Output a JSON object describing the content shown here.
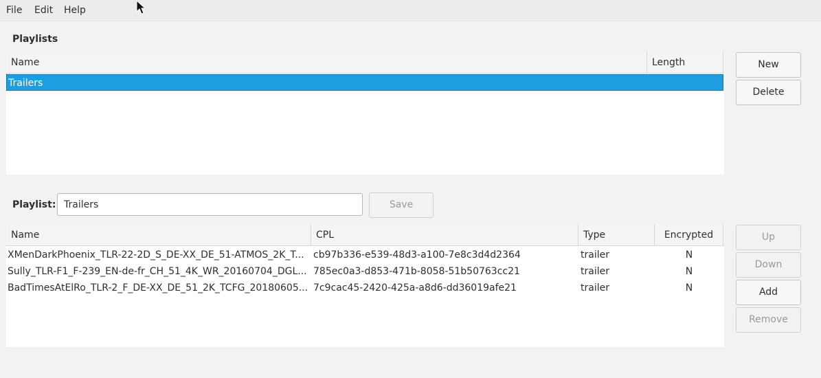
{
  "menu": {
    "file": "File",
    "edit": "Edit",
    "help": "Help"
  },
  "playlists": {
    "label": "Playlists",
    "columns": {
      "name": "Name",
      "length": "Length"
    },
    "rows": [
      {
        "name": "Trailers",
        "length": "",
        "selected": true
      }
    ],
    "buttons": {
      "new": "New",
      "delete": "Delete"
    }
  },
  "editor": {
    "label": "Playlist:",
    "name_value": "Trailers",
    "save": "Save",
    "columns": {
      "name": "Name",
      "cpl": "CPL",
      "type": "Type",
      "encrypted": "Encrypted"
    },
    "rows": [
      {
        "name": "XMenDarkPhoenix_TLR-22-2D_S_DE-XX_DE_51-ATMOS_2K_T...",
        "cpl": "cb97b336-e539-48d3-a100-7e8c3d4d2364",
        "type": "trailer",
        "encrypted": "N"
      },
      {
        "name": "Sully_TLR-F1_F-239_EN-de-fr_CH_51_4K_WR_20160704_DGL...",
        "cpl": "785ec0a3-d853-471b-8058-51b50763cc21",
        "type": "trailer",
        "encrypted": "N"
      },
      {
        "name": "BadTimesAtElRo_TLR-2_F_DE-XX_DE_51_2K_TCFG_20180605...",
        "cpl": "7c9cac45-2420-425a-a8d6-dd36019afe21",
        "type": "trailer",
        "encrypted": "N"
      }
    ],
    "buttons": {
      "up": "Up",
      "down": "Down",
      "add": "Add",
      "remove": "Remove"
    }
  },
  "colors": {
    "selection": "#1e9ee1",
    "window_bg": "#f2f2f2",
    "list_bg": "#ffffff"
  }
}
